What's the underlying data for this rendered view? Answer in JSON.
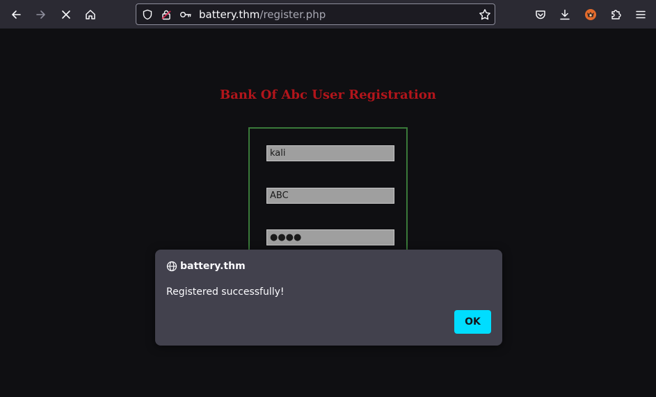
{
  "browser": {
    "url_domain": "battery.thm",
    "url_path": "/register.php"
  },
  "page": {
    "title": "Bank Of Abc User Registration",
    "fields": [
      {
        "value": "kali"
      },
      {
        "value": "ABC"
      },
      {
        "value": "●●●●"
      }
    ]
  },
  "dialog": {
    "host": "battery.thm",
    "message": "Registered successfully!",
    "ok_label": "OK"
  },
  "colors": {
    "title": "#b2151b",
    "form_border": "#3a7a3a",
    "ok_button": "#00ddff"
  }
}
